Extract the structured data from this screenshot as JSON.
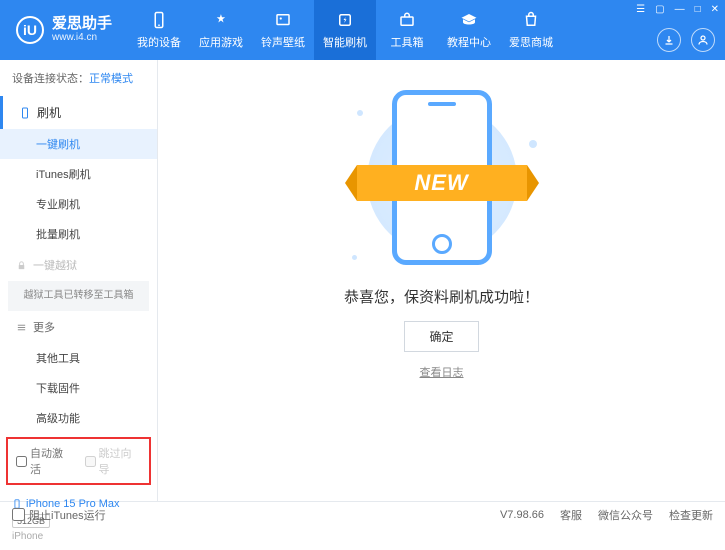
{
  "logo": {
    "badge": "iU",
    "title": "爱思助手",
    "subtitle": "www.i4.cn"
  },
  "nav": [
    {
      "label": "我的设备"
    },
    {
      "label": "应用游戏"
    },
    {
      "label": "铃声壁纸"
    },
    {
      "label": "智能刷机"
    },
    {
      "label": "工具箱"
    },
    {
      "label": "教程中心"
    },
    {
      "label": "爱思商城"
    }
  ],
  "status": {
    "label": "设备连接状态：",
    "mode": "正常模式"
  },
  "side": {
    "flash_head": "刷机",
    "items1": [
      "一键刷机",
      "iTunes刷机",
      "专业刷机",
      "批量刷机"
    ],
    "jailbreak_head": "一键越狱",
    "jailbreak_note": "越狱工具已转移至工具箱",
    "more_head": "更多",
    "items2": [
      "其他工具",
      "下载固件",
      "高级功能"
    ]
  },
  "opts": {
    "auto_activate": "自动激活",
    "skip_guide": "跳过向导"
  },
  "device": {
    "name": "iPhone 15 Pro Max",
    "storage": "512GB",
    "type": "iPhone"
  },
  "main": {
    "badge": "NEW",
    "message": "恭喜您，保资料刷机成功啦！",
    "ok": "确定",
    "log": "查看日志"
  },
  "footer": {
    "block_itunes": "阻止iTunes运行",
    "version": "V7.98.66",
    "links": [
      "客服",
      "微信公众号",
      "检查更新"
    ]
  }
}
